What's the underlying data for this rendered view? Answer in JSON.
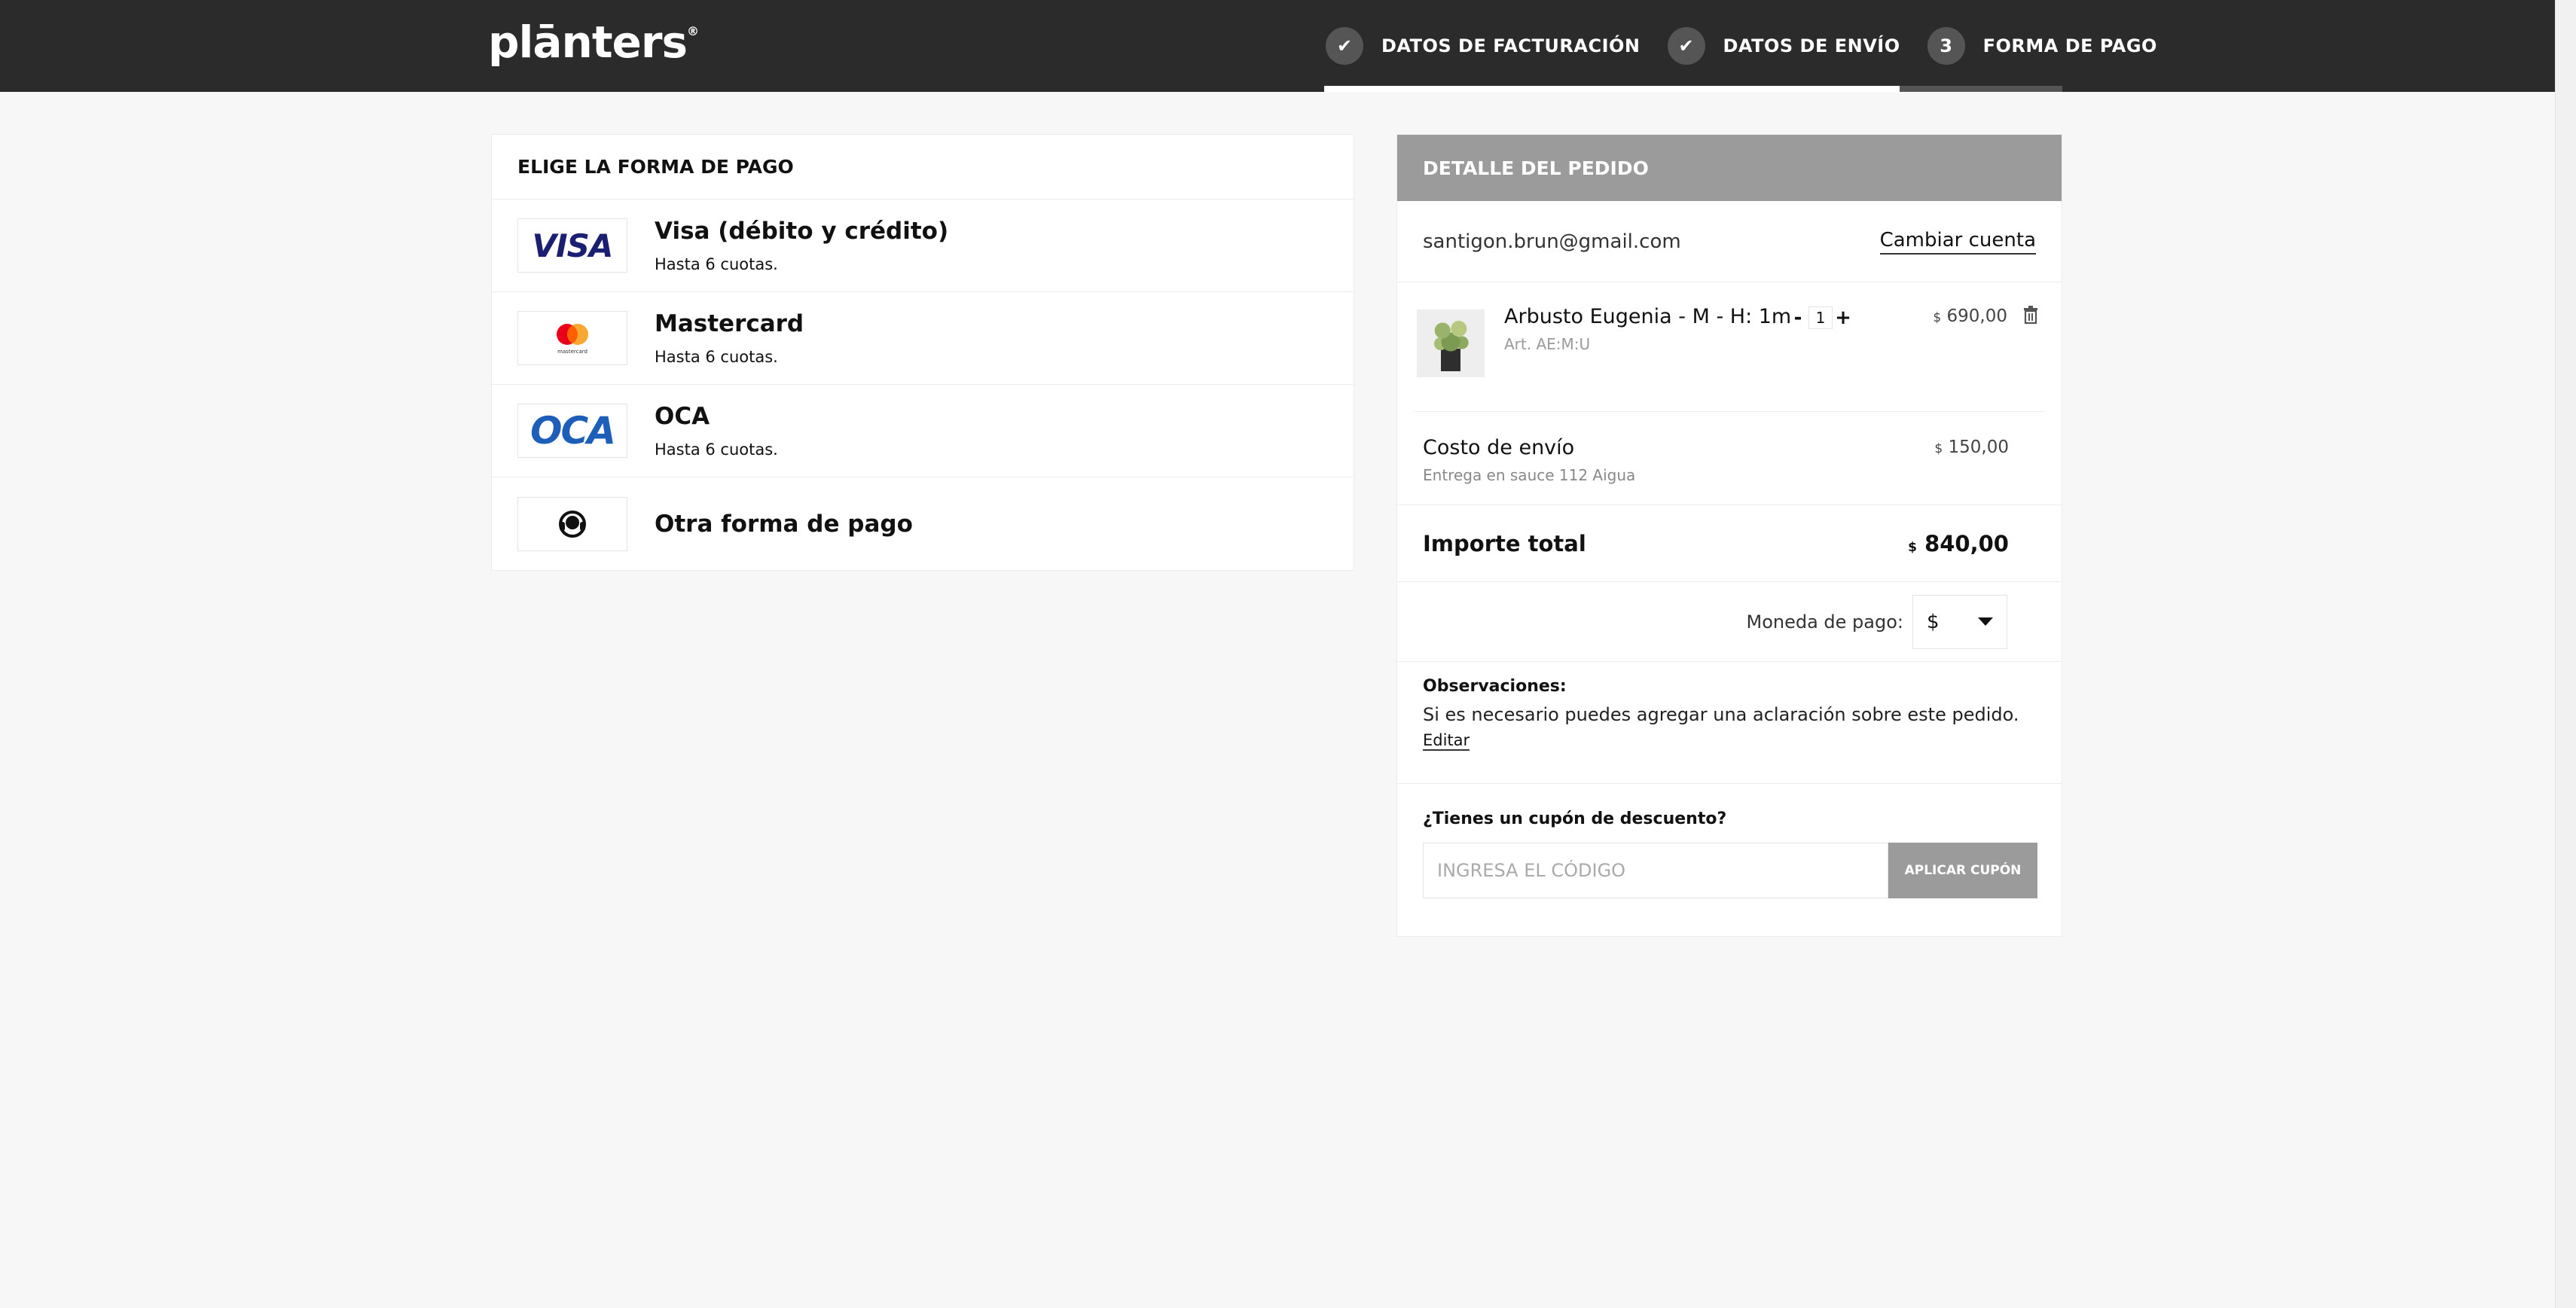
{
  "brand": {
    "name": "plānters",
    "reg": "®"
  },
  "steps": [
    {
      "number": "✔",
      "label": "DATOS DE FACTURACIÓN",
      "done": true
    },
    {
      "number": "✔",
      "label": "DATOS DE ENVÍO",
      "done": true
    },
    {
      "number": "3",
      "label": "FORMA DE PAGO",
      "done": false
    }
  ],
  "progress": {
    "fraction": 0.78
  },
  "payment": {
    "title": "ELIGE LA FORMA DE PAGO",
    "options": [
      {
        "logo": "VISA",
        "name": "Visa (débito y crédito)",
        "sub": "Hasta 6 cuotas."
      },
      {
        "logo": "mastercard",
        "name": "Mastercard",
        "sub": "Hasta 6 cuotas."
      },
      {
        "logo": "OCA",
        "name": "OCA",
        "sub": "Hasta 6 cuotas."
      },
      {
        "logo": "headset-icon",
        "name": "Otra forma de pago",
        "sub": ""
      }
    ]
  },
  "order": {
    "title": "DETALLE DEL PEDIDO",
    "email": "santigon.brun@gmail.com",
    "change_account": "Cambiar cuenta",
    "product": {
      "name": "Arbusto Eugenia - M - H: 1m",
      "art": "Art. AE:M:U",
      "qty_minus": "-",
      "qty": "1",
      "qty_plus": "+",
      "price_currency": "$",
      "price": "690,00"
    },
    "shipping": {
      "label": "Costo de envío",
      "sub": "Entrega en sauce 112 Aigua",
      "currency": "$",
      "price": "150,00"
    },
    "total": {
      "label": "Importe total",
      "currency": "$",
      "value": "840,00"
    },
    "currency": {
      "label": "Moneda de pago:",
      "selected": "$"
    },
    "notes": {
      "title": "Observaciones:",
      "text": "Si es necesario puedes agregar una aclaración sobre este pedido.",
      "edit": "Editar"
    },
    "coupon": {
      "title": "¿Tienes un cupón de descuento?",
      "placeholder": "INGRESA EL CÓDIGO",
      "button": "APLICAR CUPÓN"
    }
  },
  "colors": {
    "header": "#2b2b2b",
    "accent": "#f2a31b",
    "panel_head": "#9b9b9b"
  }
}
